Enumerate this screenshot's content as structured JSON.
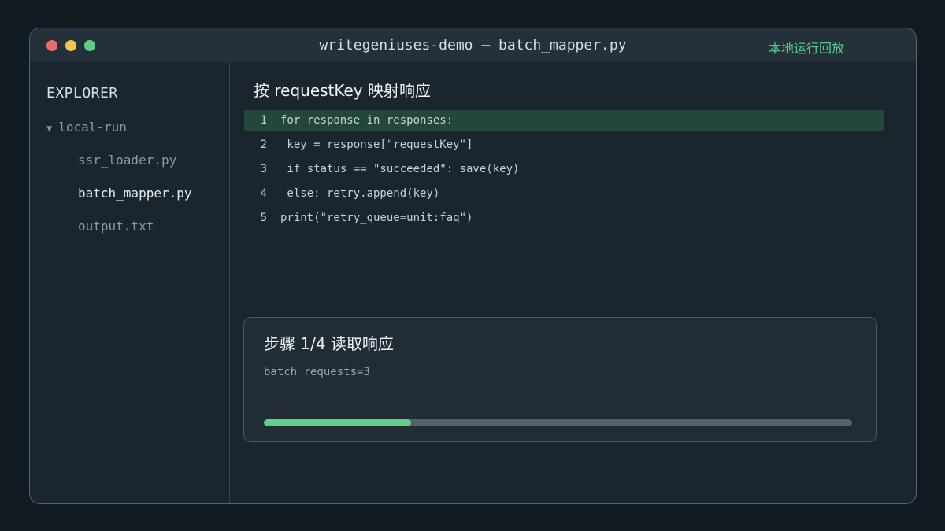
{
  "window": {
    "title": "writegeniuses-demo — batch_mapper.py",
    "replay_label": "本地运行回放"
  },
  "sidebar": {
    "title": "EXPLORER",
    "folder": "local-run",
    "files": [
      "ssr_loader.py",
      "batch_mapper.py",
      "output.txt"
    ],
    "active_file": "batch_mapper.py"
  },
  "editor": {
    "title": "按 requestKey 映射响应",
    "lines": [
      {
        "num": "1",
        "text": "for response in responses:",
        "highlighted": true
      },
      {
        "num": "2",
        "text": " key = response[\"requestKey\"]",
        "highlighted": false
      },
      {
        "num": "3",
        "text": " if status == \"succeeded\": save(key)",
        "highlighted": false
      },
      {
        "num": "4",
        "text": " else: retry.append(key)",
        "highlighted": false
      },
      {
        "num": "5",
        "text": "print(\"retry_queue=unit:faq\")",
        "highlighted": false
      }
    ]
  },
  "step": {
    "title": "步骤 1/4 读取响应",
    "detail": "batch_requests=3",
    "progress": 0.25
  },
  "colors": {
    "accent": "#5fcf86",
    "highlight_bg": "#25473a",
    "close": "#ef6b6b",
    "minimize": "#f5c453",
    "maximize": "#5fcf86"
  }
}
